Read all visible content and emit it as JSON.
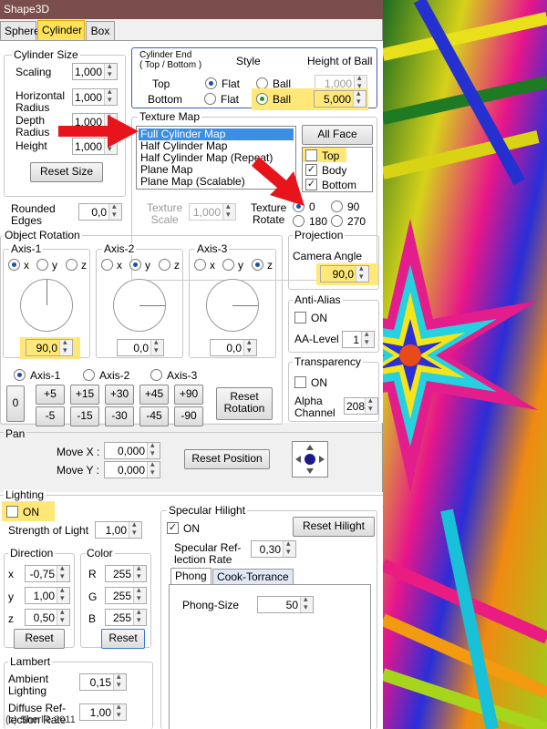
{
  "window": {
    "title": "Shape3D"
  },
  "tabs": [
    "Sphere",
    "Cylinder",
    "Box"
  ],
  "cylinder_size": {
    "title": "Cylinder Size",
    "scaling_label": "Scaling",
    "scaling": "1,000",
    "hradius_label": "Horizontal\nRadius",
    "hradius": "1,000",
    "depth_label": "Depth\nRadius",
    "depth": "1,000",
    "height_label": "Height",
    "height": "1,000",
    "reset_label": "Reset Size"
  },
  "rounded": {
    "label": "Rounded\nEdges",
    "value": "0,0"
  },
  "cylinder_end": {
    "title": "Cylinder End\n( Top / Bottom )",
    "style_label": "Style",
    "height_label": "Height of Ball",
    "top_label": "Top",
    "bottom_label": "Bottom",
    "flat_label": "Flat",
    "ball_label": "Ball",
    "top_value": "1,000",
    "bottom_value": "5,000"
  },
  "texture_map": {
    "title": "Texture Map",
    "items": [
      "Full Cylinder Map",
      "Half Cylinder Map",
      "Half Cylinder Map (Repeat)",
      "Plane Map",
      "Plane Map (Scalable)"
    ],
    "all_face_label": "All Face",
    "faces": [
      "Top",
      "Body",
      "Bottom"
    ],
    "scale_label": "Texture\nScale",
    "scale_value": "1,000",
    "rotate_label": "Texture\nRotate",
    "rotations": [
      "0",
      "90",
      "180",
      "270"
    ]
  },
  "object_rotation": {
    "title": "Object Rotation",
    "axes": [
      {
        "title": "Axis-1",
        "value": "90,0",
        "selected": "x"
      },
      {
        "title": "Axis-2",
        "value": "0,0",
        "selected": "y"
      },
      {
        "title": "Axis-3",
        "value": "0,0",
        "selected": "z"
      }
    ],
    "radio_labels": [
      "x",
      "y",
      "z"
    ],
    "axis_select": [
      "Axis-1",
      "Axis-2",
      "Axis-3"
    ],
    "zero_label": "0",
    "plus_buttons": [
      "+5",
      "+15",
      "+30",
      "+45",
      "+90"
    ],
    "minus_buttons": [
      "-5",
      "-15",
      "-30",
      "-45",
      "-90"
    ],
    "reset_label": "Reset\nRotation"
  },
  "projection": {
    "title": "Projection",
    "label": "Camera Angle",
    "value": "90,0"
  },
  "anti_alias": {
    "title": "Anti-Alias",
    "on_label": "ON",
    "level_label": "AA-Level",
    "level": "1"
  },
  "transparency": {
    "title": "Transparency",
    "on_label": "ON",
    "alpha_label": "Alpha\nChannel",
    "alpha": "208"
  },
  "pan": {
    "title": "Pan",
    "x_label": "Move X :",
    "x": "0,000",
    "y_label": "Move Y :",
    "y": "0,000",
    "reset_label": "Reset Position"
  },
  "lighting": {
    "title": "Lighting",
    "on_label": "ON",
    "strength_label": "Strength of Light",
    "strength": "1,00",
    "direction_title": "Direction",
    "dir": [
      {
        "label": "x",
        "value": "-0,75"
      },
      {
        "label": "y",
        "value": "1,00"
      },
      {
        "label": "z",
        "value": "0,50"
      }
    ],
    "color_title": "Color",
    "color": [
      {
        "label": "R",
        "value": "255"
      },
      {
        "label": "G",
        "value": "255"
      },
      {
        "label": "B",
        "value": "255"
      }
    ],
    "reset_label": "Reset",
    "lambert_title": "Lambert",
    "ambient_label": "Ambient\nLighting",
    "ambient": "0,15",
    "diffuse_label": "Diffuse Ref-\nlection Rate",
    "diffuse": "1,00"
  },
  "specular": {
    "title": "Specular Hilight",
    "on_label": "ON",
    "reset_label": "Reset Hilight",
    "rate_label": "Specular Ref-\nlection Rate",
    "rate": "0,30",
    "subtabs": [
      "Phong",
      "Cook-Torrance"
    ],
    "phong_label": "Phong-Size",
    "phong": "50"
  },
  "watermark": "(c) Sherlie 2011",
  "colors": {
    "highlight": "#ffe878",
    "arrow": "#e8141c",
    "selection": "#3a8ee6"
  }
}
